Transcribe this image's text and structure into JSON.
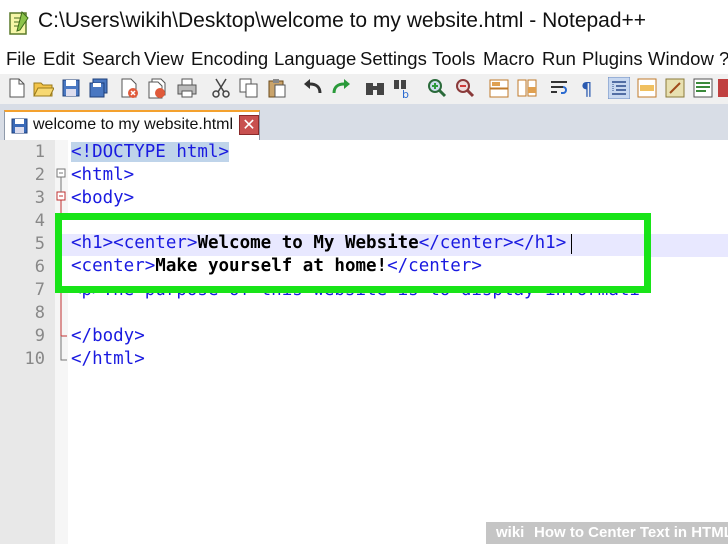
{
  "window": {
    "title": "C:\\Users\\wikih\\Desktop\\welcome to my website.html - Notepad++"
  },
  "menu": [
    "File",
    "Edit",
    "Search",
    "View",
    "Encoding",
    "Language",
    "Settings",
    "Tools",
    "Macro",
    "Run",
    "Plugins",
    "Window",
    "?"
  ],
  "toolbar_icons": [
    "new-file-icon",
    "open-file-icon",
    "save-icon",
    "save-all-icon",
    "close-icon",
    "close-all-icon",
    "print-icon",
    "cut-icon",
    "copy-icon",
    "paste-icon",
    "undo-icon",
    "redo-icon",
    "find-icon",
    "replace-icon",
    "zoom-in-icon",
    "zoom-out-icon",
    "sync-vertical-icon",
    "sync-horizontal-icon",
    "word-wrap-icon",
    "show-all-characters-icon",
    "indent-guide-icon",
    "document-map-icon",
    "function-list-icon",
    "folder-workspace-icon",
    "monitoring-icon"
  ],
  "tab": {
    "label": "welcome to my website.html",
    "close_glyph": "✕"
  },
  "editor": {
    "line_numbers": [
      "1",
      "2",
      "3",
      "4",
      "5",
      "6",
      "7",
      "8",
      "9",
      "10"
    ],
    "lines": {
      "l1": "<!DOCTYPE html>",
      "l2": "<html>",
      "l3": "<body>",
      "l5_open1": "<h1>",
      "l5_open2": "<center>",
      "l5_text": "Welcome to My Website",
      "l5_close1": "</center>",
      "l5_close2": "</h1>",
      "l6_open": "<center>",
      "l6_text": "Make yourself at home!",
      "l6_close": "</center>",
      "l7": "<p>The purpose of this website is to display informati",
      "l9": "</body>",
      "l10": "</html>"
    }
  },
  "highlight_color": "#18e418",
  "watermark": {
    "brand": "wiki",
    "text": "How to Center Text in HTML"
  }
}
